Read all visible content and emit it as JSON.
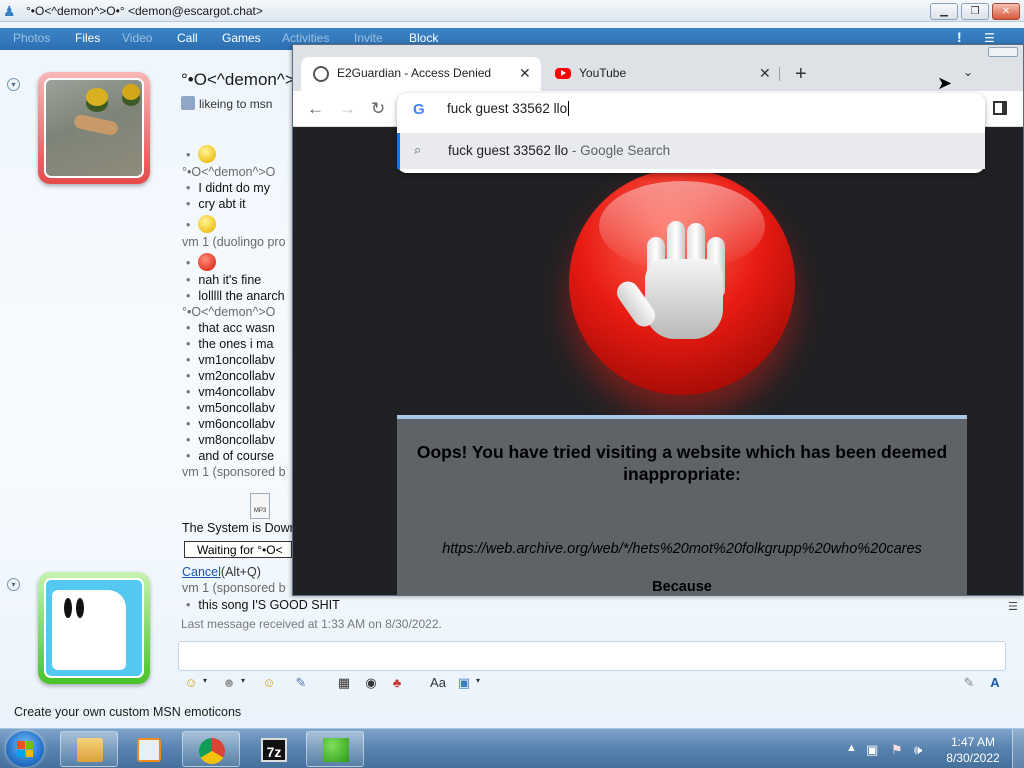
{
  "msn": {
    "title": "°•O<^demon^>O•° <demon@escargot.chat>",
    "menu": [
      "Photos",
      "Files",
      "Video",
      "Call",
      "Games",
      "Activities",
      "Invite",
      "Block"
    ],
    "contact_name": "°•O<^demon^>O",
    "contact_status": "likeing to msn",
    "messages": [
      {
        "type": "emoticon",
        "color": "yellow"
      },
      {
        "type": "meta",
        "text": "°•O<^demon^>O"
      },
      {
        "type": "bullet",
        "text": "I didnt do my"
      },
      {
        "type": "bullet",
        "text": "cry abt it"
      },
      {
        "type": "emoticon",
        "color": "yellow"
      },
      {
        "type": "meta",
        "text": "vm 1 (duolingo pro"
      },
      {
        "type": "emoticon",
        "color": "red"
      },
      {
        "type": "bullet",
        "text": "nah it's fine"
      },
      {
        "type": "bullet",
        "text": "lolllll the anarch"
      },
      {
        "type": "meta",
        "text": "°•O<^demon^>O"
      },
      {
        "type": "bullet",
        "text": "that acc wasn"
      },
      {
        "type": "bullet",
        "text": "the ones i ma"
      },
      {
        "type": "bullet",
        "text": "vm1oncollabv"
      },
      {
        "type": "bullet",
        "text": "vm2oncollabv"
      },
      {
        "type": "bullet",
        "text": "vm4oncollabv"
      },
      {
        "type": "bullet",
        "text": "vm5oncollabv"
      },
      {
        "type": "bullet",
        "text": "vm6oncollabv"
      },
      {
        "type": "bullet",
        "text": "vm8oncollabv"
      },
      {
        "type": "bullet",
        "text": "and of course"
      },
      {
        "type": "meta",
        "text": "vm 1 (sponsored b"
      }
    ],
    "system_text": "The System is Down",
    "mp3_label": "MP3",
    "waiting_text": "Waiting for °•O<",
    "cancel_link": "Cancel",
    "cancel_shortcut": "(Alt+Q)",
    "after_cancel_meta": "vm 1 (sponsored b",
    "last_bullet": "this song I'S GOOD SHIT",
    "last_received": "Last message received at 1:33 AM on 8/30/2022.",
    "footer": "Create your own custom MSN emoticons"
  },
  "chrome": {
    "tabs": [
      {
        "title": "E2Guardian - Access Denied",
        "active": true,
        "favicon": "globe-icon"
      },
      {
        "title": "YouTube",
        "active": false,
        "favicon": "youtube-icon"
      }
    ],
    "omnibox_text": "fuck guest 33562 llo",
    "suggestion_query": "fuck guest 33562 llo",
    "suggestion_suffix": "- Google Search",
    "block_title": "Oops! You have tried visiting a website which has been deemed inappropriate:",
    "block_url": "https://web.archive.org/web/*/hets%20mot%20folkgrupp%20who%20cares",
    "block_because": "Because"
  },
  "taskbar": {
    "time": "1:47 AM",
    "date": "8/30/2022"
  },
  "colors": {
    "msn_menubar": "#2c6fb0",
    "chrome_dark_bg": "#202124",
    "block_box": "#5f6368",
    "stop_red": "#e81b12"
  }
}
